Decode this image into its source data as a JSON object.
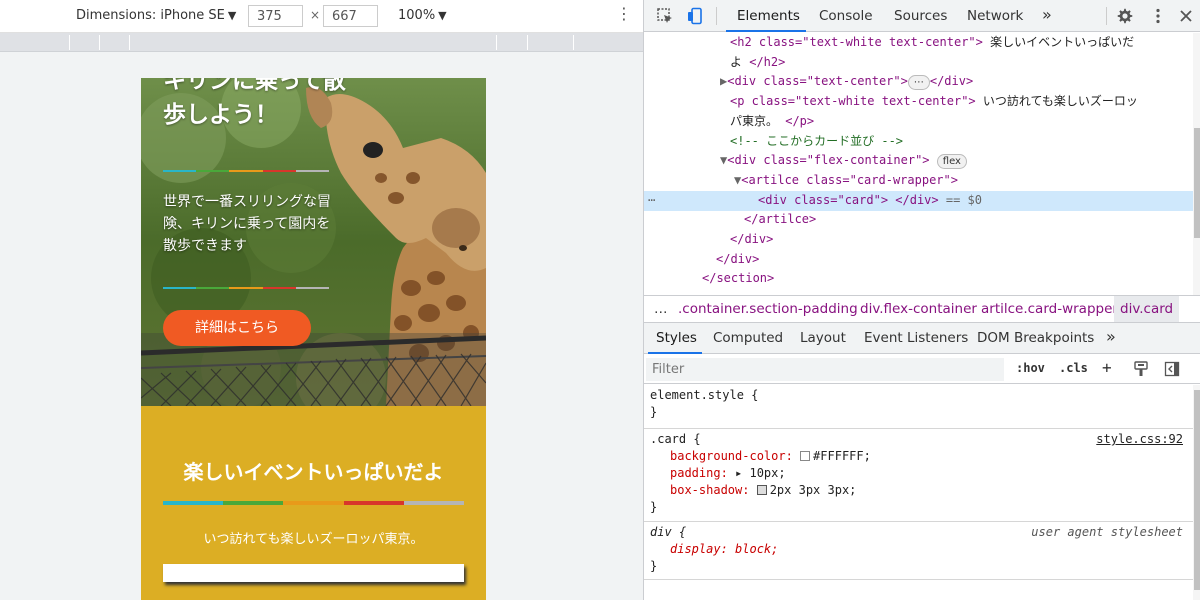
{
  "device_toolbar": {
    "dimensions_label": "Dimensions: iPhone SE",
    "caret": "▼",
    "width": "375",
    "times": "×",
    "height": "667",
    "zoom": "100%",
    "more": "⋮"
  },
  "site": {
    "hero_title": "キリンに乗って散歩しよう！",
    "hero_text": "世界で一番スリリングな冒険、キリンに乗って園内を散歩できます",
    "hero_button": "詳細はこちら",
    "event_title": "楽しいイベントいっぱいだよ",
    "event_text": "いつ訪れても楽しいズーロッパ東京。",
    "stripe_colors": [
      "#29b6c8",
      "#4aa83a",
      "#e89a1a",
      "#d8362b",
      "#b5b5b5"
    ],
    "colors": {
      "button": "#f05a23",
      "event_bg": "#dcae24"
    }
  },
  "devtools": {
    "tabs": [
      "Elements",
      "Console",
      "Sources",
      "Network"
    ],
    "tabs_more": "»",
    "dom": {
      "h2_open": "<h2 class=\"text-white text-center\">",
      "h2_text": " 楽しいイベントいっぱいだ",
      "h2_text2": "よ ",
      "h2_close": "</h2>",
      "div_tc_open": "<div class=\"text-center\">",
      "ellipsis": "⋯",
      "div_close": "</div>",
      "p_open": "<p class=\"text-white text-center\">",
      "p_text": " いつ訪れても楽しいズーロッ",
      "p_text2": "パ東京。 ",
      "p_close": "</p>",
      "comment": "<!-- ここからカード並び -->",
      "flex_open": "<div class=\"flex-container\">",
      "flex_pill": "flex",
      "article_open": "<artilce class=\"card-wrapper\">",
      "card_line": "<div class=\"card\"> </div>",
      "card_eq": " == $0",
      "row_dots": "⋯",
      "article_close": "</artilce>",
      "section_close": "</section>"
    },
    "breadcrumbs": {
      "lead": "…",
      "items": [
        ".container.section-padding",
        "div.flex-container",
        "artilce.card-wrapper",
        "div.card"
      ]
    },
    "subtabs": [
      "Styles",
      "Computed",
      "Layout",
      "Event Listeners",
      "DOM Breakpoints"
    ],
    "subtabs_more": "»",
    "filter_placeholder": "Filter",
    "hov": ":hov",
    "cls": ".cls",
    "plus": "+",
    "rules": {
      "element_style": "element.style {",
      "close_brace": "}",
      "card_selector": ".card {",
      "card_source": "style.css:92",
      "bg_prop": "background-color: ",
      "bg_val": "#FFFFFF;",
      "padding_prop": "padding: ",
      "padding_val": "▸ 10px;",
      "shadow_prop": "box-shadow: ",
      "shadow_val": "2px 3px 3px;",
      "div_selector": "div {",
      "div_source": "user agent stylesheet",
      "display_prop": "display: block;"
    }
  }
}
